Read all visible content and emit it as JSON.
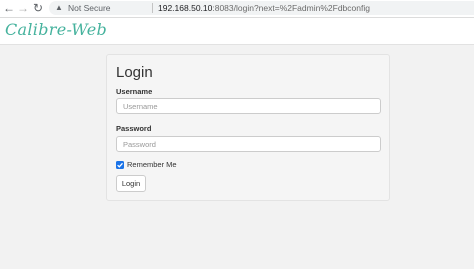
{
  "browser": {
    "back_icon": "arrow-left-icon",
    "forward_icon": "arrow-right-icon",
    "reload_icon": "reload-icon",
    "security_icon": "warning-triangle-icon",
    "security_label": "Not Secure",
    "url_host": "192.168.50.10",
    "url_rest": ":8083/login?next=%2Fadmin%2Fdbconfig"
  },
  "header": {
    "brand": "Calibre-Web",
    "brand_color": "#45b29d"
  },
  "login": {
    "title": "Login",
    "username_label": "Username",
    "username_placeholder": "Username",
    "username_value": "",
    "password_label": "Password",
    "password_placeholder": "Password",
    "password_value": "",
    "remember_label": "Remember Me",
    "remember_checked": true,
    "submit_label": "Login"
  }
}
